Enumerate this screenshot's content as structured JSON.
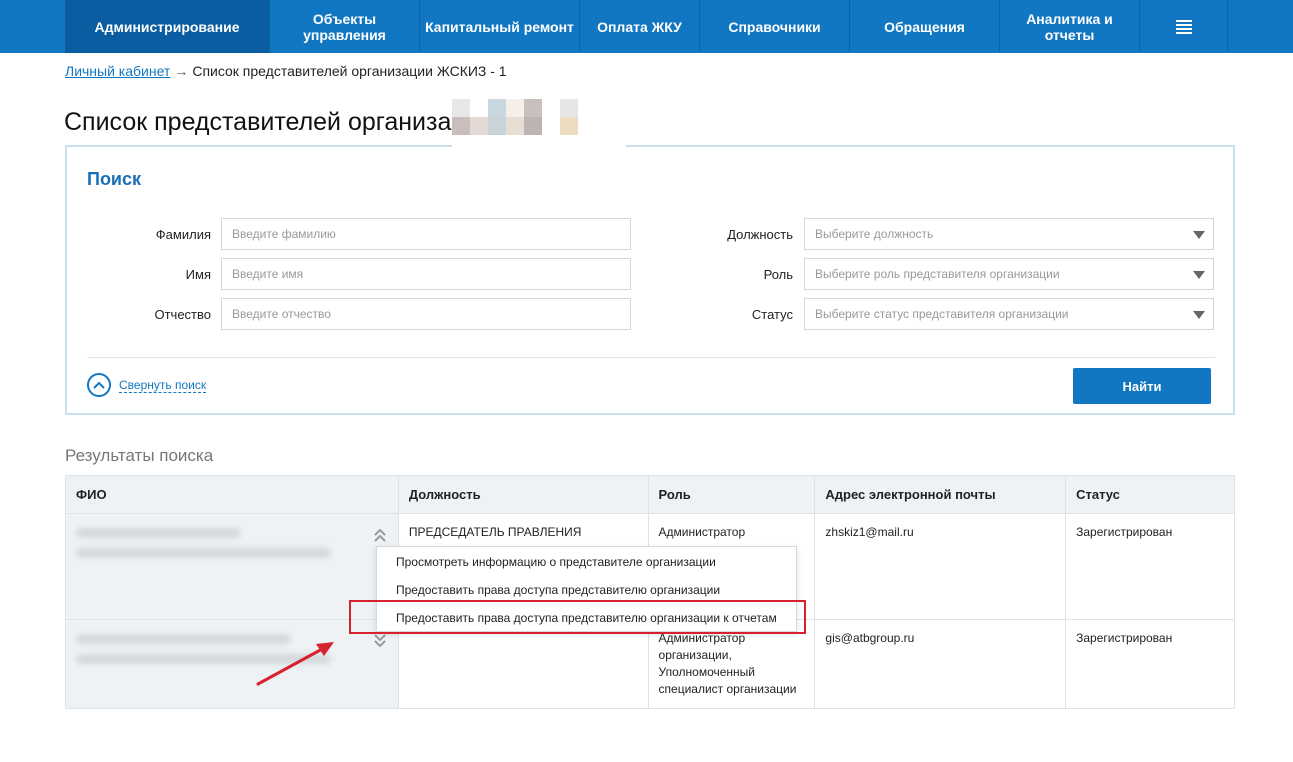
{
  "nav": {
    "items": [
      {
        "label": "Администрирование",
        "active": true
      },
      {
        "label": "Объекты\nуправления"
      },
      {
        "label": "Капитальный ремонт"
      },
      {
        "label": "Оплата ЖКУ"
      },
      {
        "label": "Справочники"
      },
      {
        "label": "Обращения"
      },
      {
        "label": "Аналитика и\nотчеты"
      }
    ],
    "menu_icon": "hamburger-menu-icon"
  },
  "breadcrumb": {
    "home": "Личный кабинет",
    "separator": "→",
    "current": "Список представителей организации ЖСКИЗ - 1"
  },
  "title": "Список представителей организации",
  "search": {
    "title": "Поиск",
    "fields": {
      "lastname": {
        "label": "Фамилия",
        "placeholder": "Введите фамилию"
      },
      "firstname": {
        "label": "Имя",
        "placeholder": "Введите имя"
      },
      "patronymic": {
        "label": "Отчество",
        "placeholder": "Введите отчество"
      },
      "position": {
        "label": "Должность",
        "placeholder": "Выберите должность"
      },
      "role": {
        "label": "Роль",
        "placeholder": "Выберите роль представителя организации"
      },
      "status": {
        "label": "Статус",
        "placeholder": "Выберите статус представителя организации"
      }
    },
    "collapse_label": "Свернуть поиск",
    "find_button": "Найти"
  },
  "results": {
    "title": "Результаты поиска",
    "columns": [
      "ФИО",
      "Должность",
      "Роль",
      "Адрес электронной почты",
      "Статус"
    ],
    "rows": [
      {
        "position": "ПРЕДСЕДАТЕЛЬ ПРАВЛЕНИЯ",
        "role": "Администратор",
        "email": "zhskiz1@mail.ru",
        "status": "Зарегистрирован"
      },
      {
        "position": "",
        "role": "Администратор организации, Уполномоченный специалист организации",
        "email": "gis@atbgroup.ru",
        "status": "Зарегистрирован"
      }
    ]
  },
  "context_menu": {
    "items": [
      "Просмотреть информацию о представителе организации",
      "Предоставить права доступа представителю организации",
      "Предоставить права доступа представителю организации к отчетам"
    ]
  },
  "colors": {
    "nav_bg": "#1277c2",
    "nav_active": "#0a5da0",
    "accent": "#1277c2",
    "highlight": "#d6212f"
  }
}
